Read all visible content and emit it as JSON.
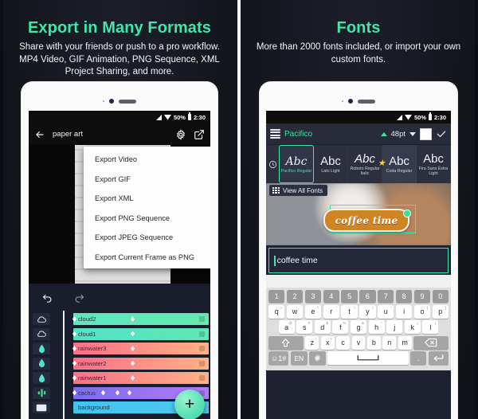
{
  "left_panel": {
    "headline": "Export in Many Formats",
    "subhead": "Share with your friends or push to a pro workflow. MP4 Video, GIF Animation, PNG Sequence, XML Project Sharing, and more.",
    "status_bar": {
      "battery_percent": "50%",
      "time": "2:30"
    },
    "app_bar": {
      "back_icon": "arrow-left-icon",
      "project_title": "paper art",
      "settings_icon": "gear-icon",
      "export_icon": "external-link-icon"
    },
    "menu": {
      "items": [
        "Export Video",
        "Export GIF",
        "Export XML",
        "Export PNG Sequence",
        "Export JPEG Sequence",
        "Export Current Frame as PNG"
      ]
    },
    "toolbar": {
      "undo_icon": "undo-arrow-icon",
      "redo_icon": "redo-arrow-icon"
    },
    "timeline": {
      "fab_label": "+",
      "layers": [
        {
          "name": "cloud2",
          "icon": "cloud-icon",
          "color_start": "#5de6c0",
          "color_end": "#63e9ae",
          "keyframes": 1
        },
        {
          "name": "cloud1",
          "icon": "cloud-icon",
          "color_start": "#53e2c6",
          "color_end": "#5fe8b4",
          "keyframes": 1
        },
        {
          "name": "rainwater3",
          "icon": "droplet-icon",
          "color_start": "#fb6f89",
          "color_end": "#ffb184",
          "keyframes": 1
        },
        {
          "name": "rainwater2",
          "icon": "droplet-icon",
          "color_start": "#fb6f89",
          "color_end": "#ffb184",
          "keyframes": 1
        },
        {
          "name": "rainwater1",
          "icon": "droplet-icon",
          "color_start": "#fb6f89",
          "color_end": "#ffb184",
          "keyframes": 1
        },
        {
          "name": "cactus",
          "icon": "cactus-icon",
          "color_start": "#7b6cf0",
          "color_end": "#b27bf5",
          "keyframes": 3
        },
        {
          "name": "background",
          "icon": "image-icon",
          "color_start": "#3fc4f0",
          "color_end": "#4cc9f0",
          "keyframes": 0
        }
      ]
    }
  },
  "right_panel": {
    "headline": "Fonts",
    "subhead": "More than 2000 fonts included, or import your own custom fonts.",
    "status_bar": {
      "battery_percent": "50%",
      "time": "2:30"
    },
    "font_toolbar": {
      "align_icon": "text-lines-icon",
      "font_name": "Pacifico",
      "expand_icon": "chevron-up-icon",
      "font_size": "48pt",
      "size_dropdown_icon": "chevron-down-icon",
      "color_swatch": "#ffffff",
      "confirm_icon": "check-icon"
    },
    "font_strip": {
      "recent_icon": "clock-icon",
      "starred_index": 3,
      "fonts": [
        {
          "sample": "Abc",
          "name": "Pacifico Regular",
          "selected": true
        },
        {
          "sample": "Abc",
          "name": "Lato Light",
          "selected": false
        },
        {
          "sample": "Abc",
          "name": "Roboto Regular Italic",
          "selected": false
        },
        {
          "sample": "Abc",
          "name": "Coda Regular",
          "selected": false
        },
        {
          "sample": "Abc",
          "name": "Fira Sans Extra Light",
          "selected": false
        }
      ]
    },
    "view_all_fonts": {
      "label": "View All Fonts",
      "icon": "grid-icon"
    },
    "canvas": {
      "sticker_text": "coffee time"
    },
    "text_input": {
      "value": "coffee time"
    },
    "keyboard": {
      "row_numbers": [
        "1",
        "2",
        "3",
        "4",
        "5",
        "6",
        "7",
        "8",
        "9",
        "0"
      ],
      "row1": [
        "q",
        "w",
        "e",
        "r",
        "t",
        "y",
        "u",
        "i",
        "o",
        "p"
      ],
      "row1_sup": [
        "~",
        "`",
        "^",
        "'",
        "\\",
        "/",
        "\"",
        "'",
        "|",
        "]"
      ],
      "row2": [
        "a",
        "s",
        "d",
        "f",
        "g",
        "h",
        "j",
        "k",
        "l"
      ],
      "row2_sup": [
        "@",
        "#",
        "$",
        "%",
        "&",
        "*",
        "-",
        "(",
        ")"
      ],
      "row3": [
        "z",
        "x",
        "c",
        "v",
        "b",
        "n",
        "m"
      ],
      "shift_icon": "shift-up-icon",
      "backspace_icon": "backspace-icon",
      "symbols_key": "☺1#",
      "language_key": "EN",
      "settings_key": "gear-icon",
      "space_icon": "space-bar-icon",
      "period_key": ".",
      "enter_icon": "enter-icon"
    }
  },
  "theme": {
    "accent_green": "#3de8a9",
    "background_dark": "#12141e",
    "panel_dark": "#191d2c",
    "text_light": "#f3f5f7"
  }
}
